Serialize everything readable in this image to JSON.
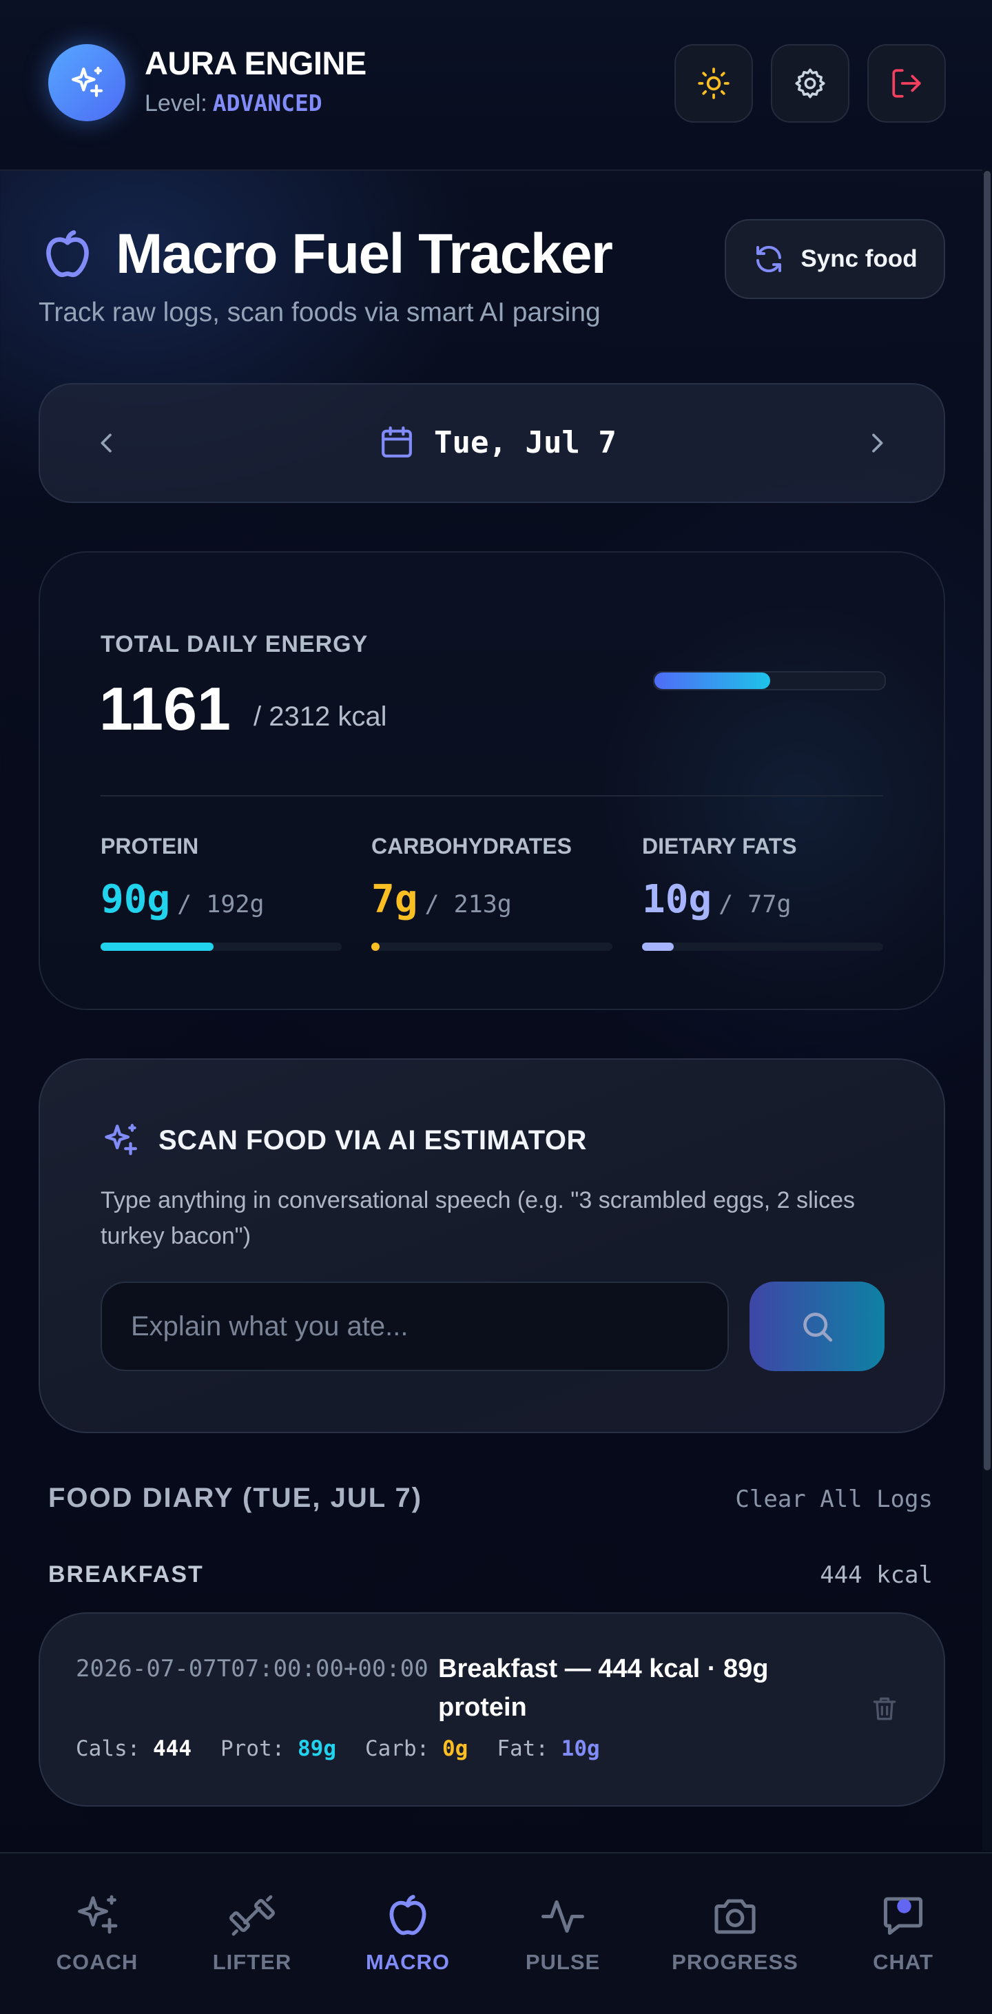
{
  "header": {
    "app_title": "AURA ENGINE",
    "level_label": "Level:",
    "level_value": "ADVANCED"
  },
  "page": {
    "title": "Macro Fuel Tracker",
    "subtitle": "Track raw logs, scan foods via smart AI parsing",
    "sync_label": "Sync food"
  },
  "date_nav": {
    "label": "Tue, Jul 7"
  },
  "energy": {
    "label": "TOTAL DAILY ENERGY",
    "value": "1161",
    "target": "/ 2312 kcal",
    "progress": 0.502
  },
  "macros": [
    {
      "name": "PROTEIN",
      "current": "90g",
      "goal": "/ 192g",
      "progress": 0.469,
      "color": "#22d3ee"
    },
    {
      "name": "CARBOHYDRATES",
      "current": "7g",
      "goal": "/ 213g",
      "progress": 0.033,
      "color": "#fbbf24"
    },
    {
      "name": "DIETARY FATS",
      "current": "10g",
      "goal": "/ 77g",
      "progress": 0.13,
      "color": "#a5b4fc"
    }
  ],
  "scan": {
    "title": "SCAN FOOD VIA AI ESTIMATOR",
    "description": "Type anything in conversational speech (e.g. \"3 scrambled eggs, 2 slices turkey bacon\")",
    "placeholder": "Explain what you ate..."
  },
  "diary": {
    "title": "FOOD DIARY (TUE, JUL 7)",
    "clear_label": "Clear All Logs",
    "meals": [
      {
        "name": "BREAKFAST",
        "kcal": "444 kcal",
        "entries": [
          {
            "timestamp": "2026-07-07T07:00:00+00:00",
            "description": "Breakfast — 444 kcal · 89g protein",
            "cals_label": "Cals:",
            "cals": "444",
            "prot_label": "Prot:",
            "prot": "89g",
            "carb_label": "Carb:",
            "carb": "0g",
            "fat_label": "Fat:",
            "fat": "10g"
          }
        ]
      }
    ]
  },
  "nav": [
    {
      "label": "COACH",
      "icon": "sparkle-icon"
    },
    {
      "label": "LIFTER",
      "icon": "dumbbell-icon"
    },
    {
      "label": "MACRO",
      "icon": "apple-icon",
      "active": true
    },
    {
      "label": "PULSE",
      "icon": "pulse-icon"
    },
    {
      "label": "PROGRESS",
      "icon": "camera-icon"
    },
    {
      "label": "CHAT",
      "icon": "chat-icon"
    }
  ],
  "colors": {
    "accent": "#818cf8",
    "protein": "#22d3ee",
    "carbs": "#fbbf24",
    "fats": "#a5b4fc",
    "danger": "#f43f5e",
    "sun": "#fbbf24"
  }
}
